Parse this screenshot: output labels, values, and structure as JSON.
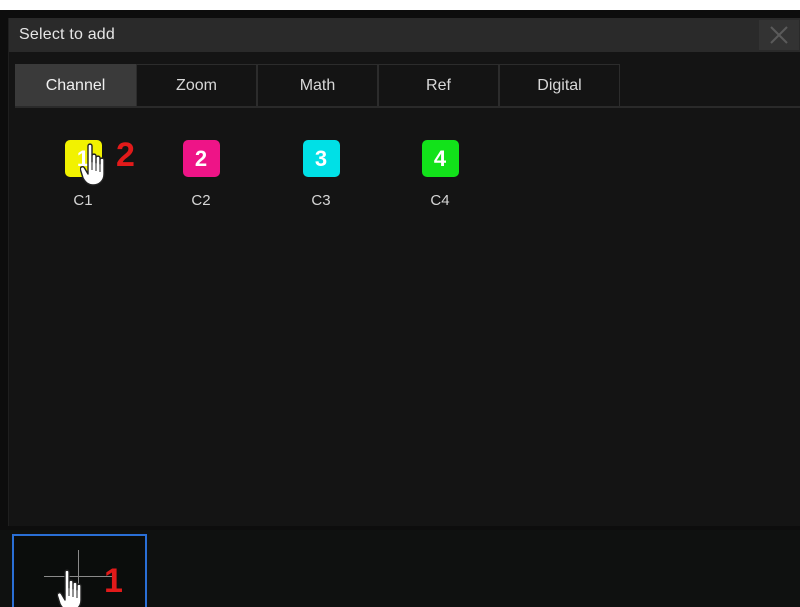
{
  "dialog": {
    "title": "Select to add",
    "close_icon": "close-icon"
  },
  "tabs": [
    {
      "label": "Channel",
      "active": true
    },
    {
      "label": "Zoom",
      "active": false
    },
    {
      "label": "Math",
      "active": false
    },
    {
      "label": "Ref",
      "active": false
    },
    {
      "label": "Digital",
      "active": false
    }
  ],
  "channels": [
    {
      "number": "1",
      "label": "C1",
      "color": "#f2f200"
    },
    {
      "number": "2",
      "label": "C2",
      "color": "#ee1487"
    },
    {
      "number": "3",
      "label": "C3",
      "color": "#00e0e6"
    },
    {
      "number": "4",
      "label": "C4",
      "color": "#12e21a"
    }
  ],
  "annotations": {
    "step_1": "1",
    "step_2": "2",
    "marker_color": "#e21a1a",
    "hand_icon": "hand-pointer-icon"
  },
  "bottom": {
    "slot_icon": "crosshair-icon",
    "slot_border_color": "#2a6fd6"
  }
}
